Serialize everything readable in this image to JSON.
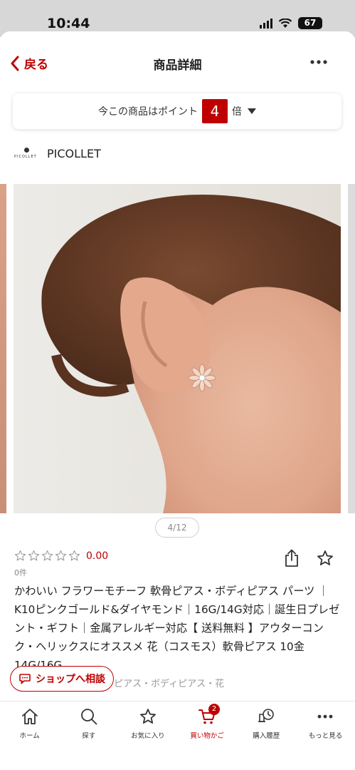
{
  "status": {
    "time": "10:44",
    "battery": "67"
  },
  "nav": {
    "back_label": "戻る",
    "title": "商品詳細",
    "more_icon": "more-dots-icon"
  },
  "points": {
    "prefix": "今この商品はポイント",
    "multiplier": "4",
    "suffix": "倍"
  },
  "shop": {
    "logo_text": "PICOLLET",
    "name": "PICOLLET"
  },
  "gallery": {
    "pager": "4/12"
  },
  "rating": {
    "stars_filled": 0,
    "stars_total": 5,
    "value": "0.00",
    "count": "0件"
  },
  "product": {
    "title": "かわいい フラワーモチーフ 軟骨ピアス・ボディピアス パーツ ｜ K10ピンクゴールド&ダイヤモンド｜16G/14G対応｜誕生日プレゼント・ギフト｜金属アレルギー対応【 送料無料 】アウターコンク・ヘリックスにオススメ 花（コスモス）軟骨ピアス 10金 14G/16G",
    "tags": "ピアス・ボディピアス・花"
  },
  "chat": {
    "label": "ショップへ相談"
  },
  "tabbar": {
    "items": [
      {
        "label": "ホーム",
        "icon": "home-icon"
      },
      {
        "label": "探す",
        "icon": "search-icon"
      },
      {
        "label": "お気に入り",
        "icon": "star-icon"
      },
      {
        "label": "買い物かご",
        "icon": "cart-icon",
        "badge": "2",
        "active": true
      },
      {
        "label": "購入履歴",
        "icon": "history-icon"
      },
      {
        "label": "もっと見る",
        "icon": "more-dots-icon"
      }
    ]
  },
  "colors": {
    "accent": "#bf0000",
    "text": "#222222",
    "muted": "#888888"
  }
}
